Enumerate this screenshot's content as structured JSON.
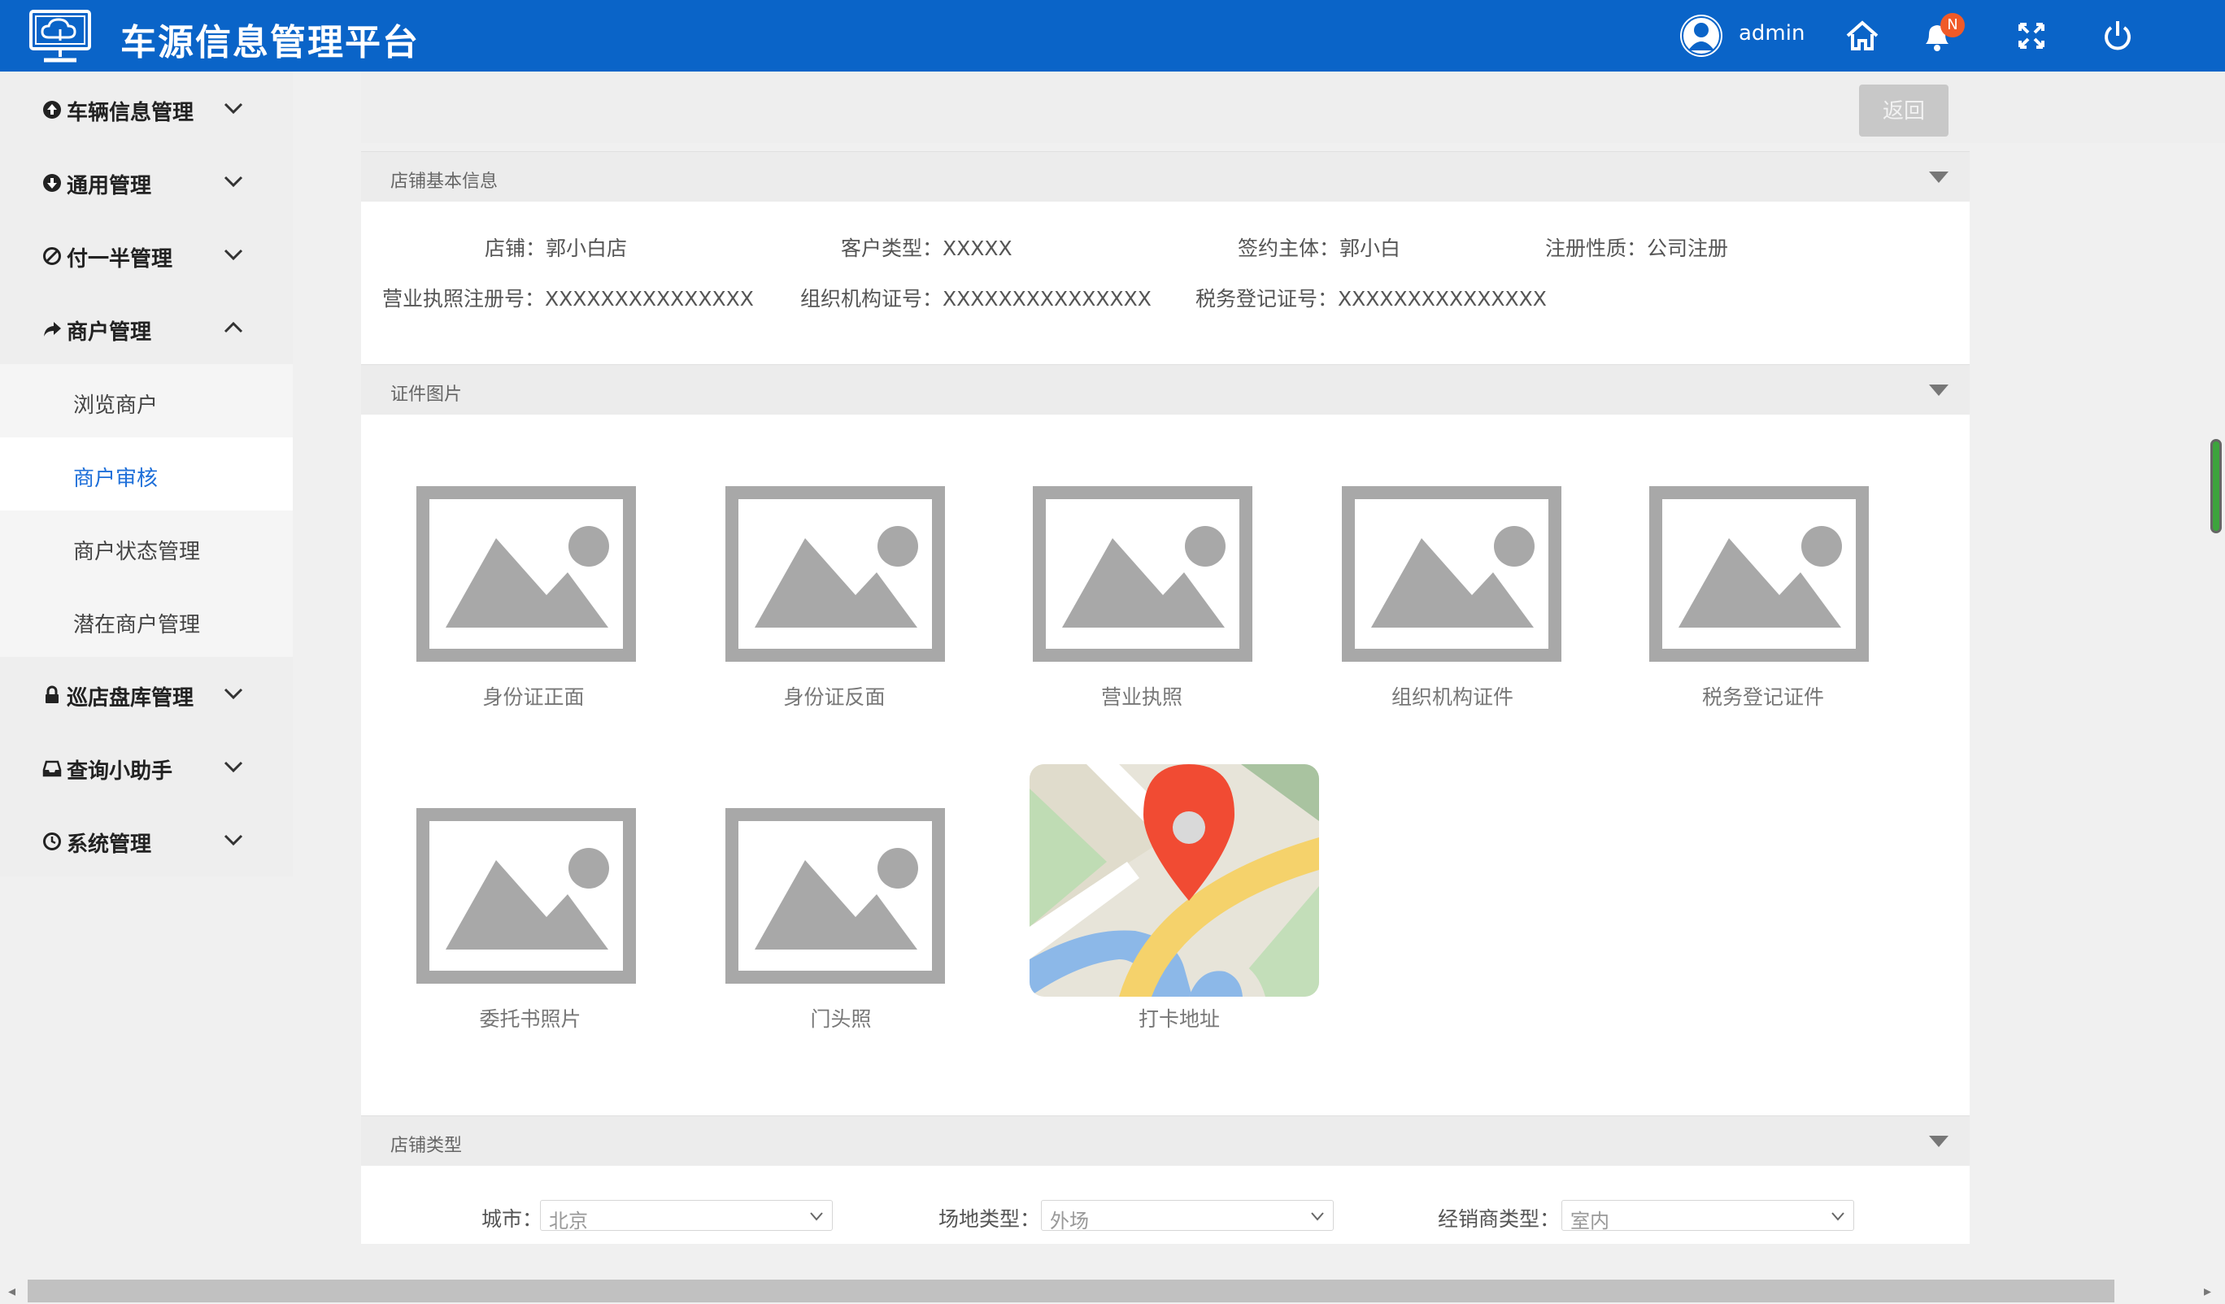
{
  "header": {
    "app_title": "车源信息管理平台",
    "username": "admin",
    "notification_badge": "N",
    "icons": [
      "monitor-cloud-icon",
      "user-avatar-icon",
      "home-icon",
      "bell-icon",
      "fullscreen-icon",
      "power-icon"
    ]
  },
  "sidebar": {
    "items": [
      {
        "label": "车辆信息管理",
        "icon": "arrow-circle-up-icon",
        "expanded": false
      },
      {
        "label": "通用管理",
        "icon": "arrow-circle-down-icon",
        "expanded": false
      },
      {
        "label": "付一半管理",
        "icon": "ban-icon",
        "expanded": false
      },
      {
        "label": "商户管理",
        "icon": "share-icon",
        "expanded": true
      },
      {
        "label": "巡店盘库管理",
        "icon": "lock-icon",
        "expanded": false
      },
      {
        "label": "查询小助手",
        "icon": "inbox-icon",
        "expanded": false
      },
      {
        "label": "系统管理",
        "icon": "clock-icon",
        "expanded": false
      }
    ],
    "sub_items": [
      {
        "label": "浏览商户",
        "active": false
      },
      {
        "label": "商户审核",
        "active": true
      },
      {
        "label": "商户状态管理",
        "active": false
      },
      {
        "label": "潜在商户管理",
        "active": false
      }
    ]
  },
  "toolbar": {
    "back_label": "返回"
  },
  "store_info": {
    "title": "店铺基本信息",
    "row1": [
      "店铺：郭小白店",
      "客户类型：XXXXX",
      "签约主体：郭小白",
      "注册性质：公司注册"
    ],
    "row2": [
      "营业执照注册号：XXXXXXXXXXXXXXX",
      "组织机构证号：XXXXXXXXXXXXXXX",
      "税务登记证号：XXXXXXXXXXXXXXX"
    ]
  },
  "certificates": {
    "title": "证件图片",
    "photos": [
      "身份证正面",
      "身份证反面",
      "营业执照",
      "组织机构证件",
      "税务登记证件",
      "委托书照片",
      "门头照"
    ],
    "map_caption": "打卡地址"
  },
  "store_type": {
    "title": "店铺类型",
    "fields": [
      {
        "label": "城市：",
        "value": "北京"
      },
      {
        "label": "场地类型：",
        "value": "外场"
      },
      {
        "label": "经销商类型：",
        "value": "室内"
      }
    ]
  },
  "colors": {
    "header_bg": "#0a64c8",
    "active_link": "#1e6fd9",
    "badge": "#f05a28",
    "placeholder_gray": "#a8a8a8"
  }
}
